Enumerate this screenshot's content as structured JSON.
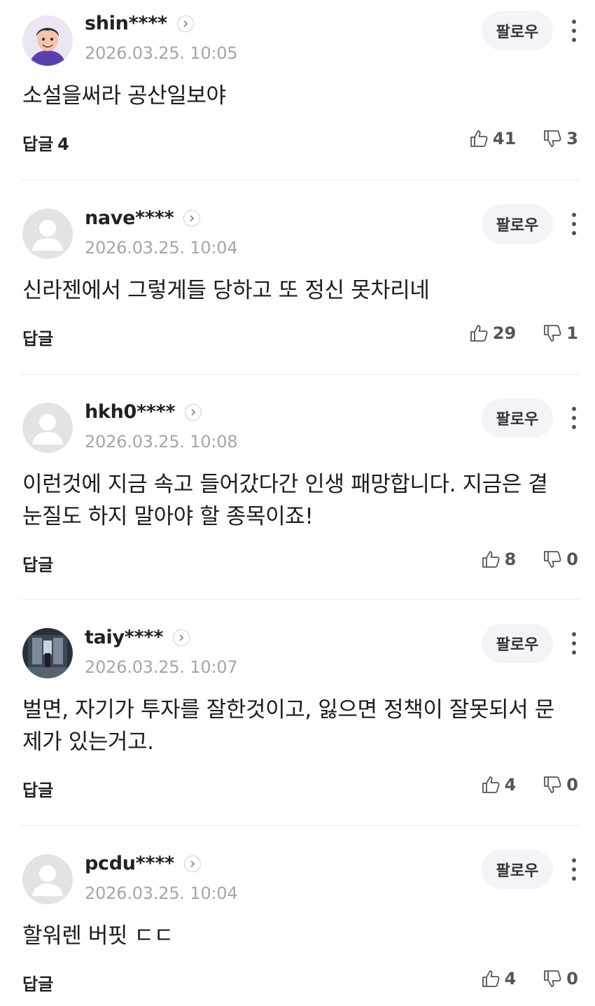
{
  "follow_label": "팔로우",
  "reply_label": "답글",
  "comments": [
    {
      "username": "shin****",
      "timestamp": "2026.03.25. 10:05",
      "text": "소설을써라 공산일보야",
      "reply_count": "4",
      "likes": "41",
      "dislikes": "3",
      "avatar": "cartoon-avatar"
    },
    {
      "username": "nave****",
      "timestamp": "2026.03.25. 10:04",
      "text": "신라젠에서 그렇게들 당하고 또 정신 못차리네",
      "reply_count": "",
      "likes": "29",
      "dislikes": "1",
      "avatar": "default-avatar"
    },
    {
      "username": "hkh0****",
      "timestamp": "2026.03.25. 10:08",
      "text": "이런것에 지금 속고 들어갔다간 인생 패망합니다. 지금은 곁눈질도 하지 말아야 할 종목이죠!",
      "reply_count": "",
      "likes": "8",
      "dislikes": "0",
      "avatar": "default-avatar"
    },
    {
      "username": "taiy****",
      "timestamp": "2026.03.25. 10:07",
      "text": "벌면, 자기가 투자를 잘한것이고, 잃으면 정책이 잘못되서 문제가 있는거고.",
      "reply_count": "",
      "likes": "4",
      "dislikes": "0",
      "avatar": "photo-avatar"
    },
    {
      "username": "pcdu****",
      "timestamp": "2026.03.25. 10:04",
      "text": "할워렌 버핏 ㄷㄷ",
      "reply_count": "",
      "likes": "4",
      "dislikes": "0",
      "avatar": "default-avatar"
    }
  ]
}
